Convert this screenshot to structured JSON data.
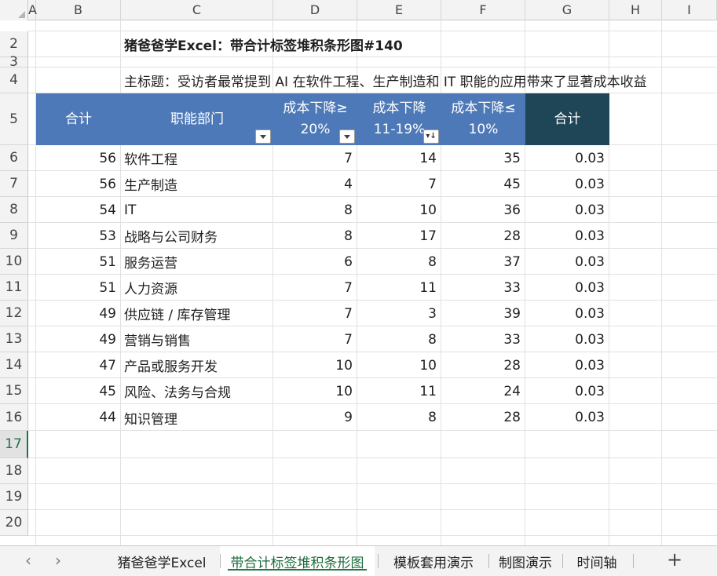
{
  "columns": [
    "A",
    "B",
    "C",
    "D",
    "E",
    "F",
    "G",
    "H",
    "I"
  ],
  "rows": [
    "2",
    "3",
    "4",
    "5",
    "6",
    "7",
    "8",
    "9",
    "10",
    "11",
    "12",
    "13",
    "14",
    "15",
    "16",
    "17",
    "18",
    "19",
    "20"
  ],
  "title": "猪爸爸学Excel：带合计标签堆积条形图#140",
  "subtitle": "主标题：受访者最常提到 AI 在软件工程、生产制造和 IT 职能的应用带来了显著成本收益",
  "header": {
    "total": "合计",
    "dept": "职能部门",
    "d": "成本下降≥\n20%",
    "e": "成本下降\n11-19%",
    "f": "成本下降≤\n10%",
    "g": "合计"
  },
  "table": [
    {
      "total": "56",
      "dept": "软件工程",
      "d": "7",
      "e": "14",
      "f": "35",
      "g": "0.03"
    },
    {
      "total": "56",
      "dept": "生产制造",
      "d": "4",
      "e": "7",
      "f": "45",
      "g": "0.03"
    },
    {
      "total": "54",
      "dept": "IT",
      "d": "8",
      "e": "10",
      "f": "36",
      "g": "0.03"
    },
    {
      "total": "53",
      "dept": "战略与公司财务",
      "d": "8",
      "e": "17",
      "f": "28",
      "g": "0.03"
    },
    {
      "total": "51",
      "dept": "服务运营",
      "d": "6",
      "e": "8",
      "f": "37",
      "g": "0.03"
    },
    {
      "total": "51",
      "dept": "人力资源",
      "d": "7",
      "e": "11",
      "f": "33",
      "g": "0.03"
    },
    {
      "total": "49",
      "dept": "供应链 / 库存管理",
      "d": "7",
      "e": "3",
      "f": "39",
      "g": "0.03"
    },
    {
      "total": "49",
      "dept": "营销与销售",
      "d": "7",
      "e": "8",
      "f": "33",
      "g": "0.03"
    },
    {
      "total": "47",
      "dept": "产品或服务开发",
      "d": "10",
      "e": "10",
      "f": "28",
      "g": "0.03"
    },
    {
      "total": "45",
      "dept": "风险、法务与合规",
      "d": "10",
      "e": "11",
      "f": "24",
      "g": "0.03"
    },
    {
      "total": "44",
      "dept": "知识管理",
      "d": "9",
      "e": "8",
      "f": "28",
      "g": "0.03"
    }
  ],
  "tabs": [
    "猪爸爸学Excel",
    "带合计标签堆积条形图",
    "模板套用演示",
    "制图演示",
    "时间轴"
  ],
  "active_tab": 1,
  "selected_row": "17",
  "colors": {
    "header_blue": "#4e79b8",
    "header_dark": "#1f4656",
    "accent_green": "#217346"
  },
  "icons": {
    "scroll_left": "chevron-left-icon",
    "scroll_right": "chevron-right-icon",
    "add_sheet": "plus-icon",
    "filter": "filter-dropdown-icon",
    "sort": "sort-descending-icon"
  }
}
